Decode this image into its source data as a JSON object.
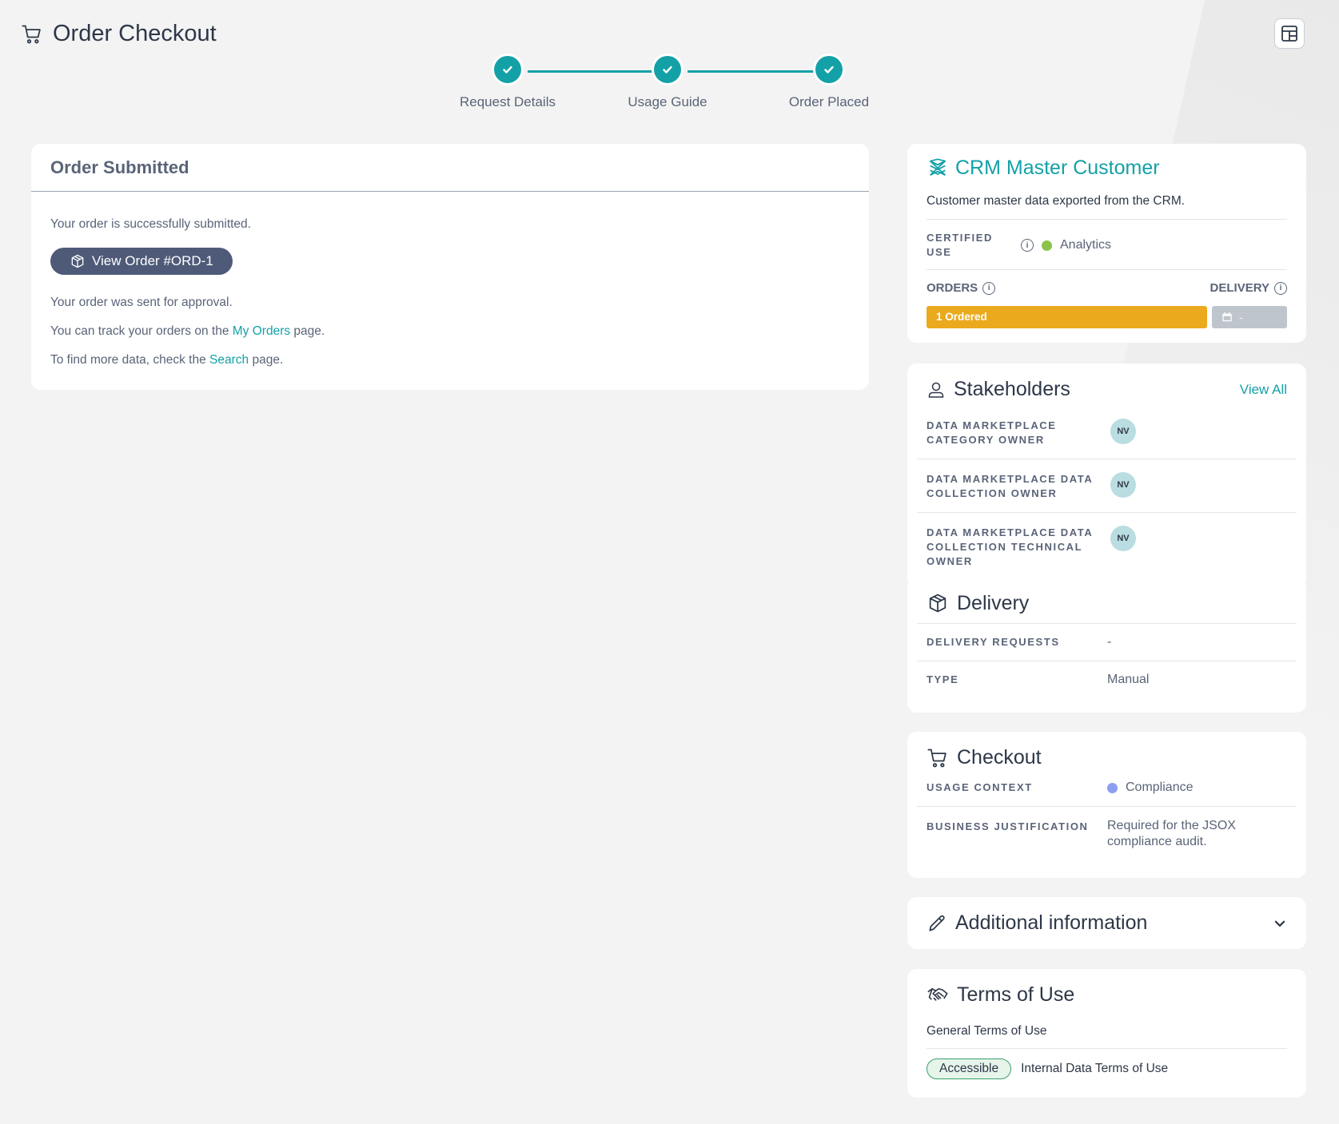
{
  "header": {
    "title": "Order Checkout"
  },
  "stepper": {
    "steps": [
      {
        "label": "Request Details"
      },
      {
        "label": "Usage Guide"
      },
      {
        "label": "Order Placed"
      }
    ]
  },
  "order": {
    "title": "Order Submitted",
    "success_text": "Your order is successfully submitted.",
    "view_order_label": "View Order #ORD-1",
    "approval_text": "Your order was sent for approval.",
    "track_prefix": "You can track your orders on the",
    "track_link": "My Orders",
    "track_suffix": "page.",
    "find_prefix": "To find more data, check the",
    "find_link": "Search",
    "find_suffix": "page."
  },
  "product": {
    "name": "CRM Master Customer",
    "description": "Customer master data exported from the CRM.",
    "certified_label": "CERTIFIED USE",
    "certified_value": "Analytics",
    "certified_color": "#8bc34a",
    "orders_label": "ORDERS",
    "delivery_label": "DELIVERY",
    "ordered_bar": "1 Ordered",
    "delivery_bar": "-"
  },
  "stakeholders": {
    "title": "Stakeholders",
    "view_all": "View All",
    "items": [
      {
        "role": "DATA MARKETPLACE CATEGORY OWNER",
        "initials": "NV"
      },
      {
        "role": "DATA MARKETPLACE DATA COLLECTION OWNER",
        "initials": "NV"
      },
      {
        "role": "DATA MARKETPLACE DATA COLLECTION TECHNICAL OWNER",
        "initials": "NV"
      }
    ]
  },
  "delivery": {
    "title": "Delivery",
    "requests_label": "DELIVERY REQUESTS",
    "requests_value": "-",
    "type_label": "TYPE",
    "type_value": "Manual"
  },
  "checkout": {
    "title": "Checkout",
    "usage_label": "USAGE CONTEXT",
    "usage_value": "Compliance",
    "usage_color": "#8c9ef0",
    "justification_label": "BUSINESS JUSTIFICATION",
    "justification_value": "Required for the JSOX compliance audit."
  },
  "additional": {
    "title": "Additional information"
  },
  "terms": {
    "title": "Terms of Use",
    "general": "General Terms of Use",
    "badge": "Accessible",
    "internal": "Internal Data Terms of Use"
  },
  "colors": {
    "accent": "#13a1a7",
    "primary_button": "#4e5a78",
    "ordered": "#ebaa1d"
  }
}
